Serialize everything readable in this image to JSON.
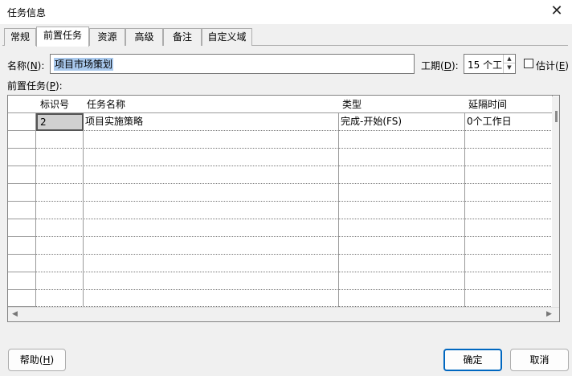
{
  "window": {
    "title": "任务信息",
    "close_glyph": "✕"
  },
  "tabs": [
    {
      "label": "常规",
      "active": false
    },
    {
      "label": "前置任务",
      "active": true
    },
    {
      "label": "资源",
      "active": false
    },
    {
      "label": "高级",
      "active": false
    },
    {
      "label": "备注",
      "active": false
    },
    {
      "label": "自定义域",
      "active": false
    }
  ],
  "form": {
    "name_label": "名称(",
    "name_key": "N",
    "name_label_end": "):",
    "name_value": "项目市场策划",
    "duration_label": "工期(",
    "duration_key": "D",
    "duration_label_end": "):",
    "duration_value": "15 个工",
    "estimate_label": "估计(",
    "estimate_key": "E",
    "estimate_label_end": ")",
    "estimate_checked": false,
    "predecessors_label": "前置任务(",
    "predecessors_key": "P",
    "predecessors_label_end": "):"
  },
  "grid": {
    "columns": [
      "标识号",
      "任务名称",
      "类型",
      "延隔时间"
    ],
    "rows": [
      {
        "id": "2",
        "name": "项目实施策略",
        "type": "完成-开始(FS)",
        "lag": "0个工作日"
      }
    ]
  },
  "buttons": {
    "help_label": "帮助(",
    "help_key": "H",
    "help_label_end": ")",
    "ok_label": "确定",
    "cancel_label": "取消"
  },
  "icons": {
    "spin_up": "▲",
    "spin_down": "▼",
    "scroll_left": "◀",
    "scroll_right": "▶"
  },
  "colors": {
    "selection": "#a8c8ec",
    "primary_button_border": "#0067c0"
  }
}
